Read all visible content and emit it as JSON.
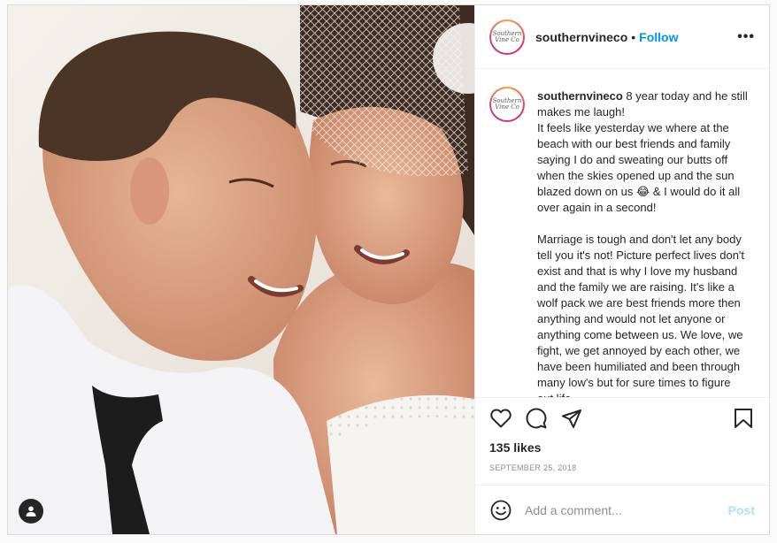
{
  "post": {
    "username": "southernvineco",
    "avatar_text": "Southern Vine Co",
    "header": {
      "separator": "•",
      "follow_label": "Follow",
      "more_label": "•••"
    },
    "caption": {
      "username": "southernvineco",
      "first_line": " 8 year today and he still makes me laugh!",
      "paragraph1": "It feels like yesterday we where at the beach with our best friends and family saying I do and sweating our butts off when the skies opened up and the sun blazed down on us 😂 & I would do it all over again in a second!",
      "paragraph2": "Marriage is tough and don't let any body tell you it's not! Picture perfect lives don't exist and that is why I love my husband and the family we are raising. It's like a wolf pack we are best friends more then anything and would not let anyone or anything come between us. We love, we fight, we get annoyed by each other, we have been humiliated and been through many low's but for sure times to figure out life"
    },
    "likes": "135 likes",
    "date": "SEPTEMBER 25, 2018",
    "comment_input": {
      "placeholder": "Add a comment...",
      "value": ""
    },
    "post_button": "Post",
    "icons": {
      "like": "heart-icon",
      "comment": "comment-icon",
      "share": "share-icon",
      "save": "bookmark-icon",
      "emoji": "emoji-icon",
      "user_tag": "user-icon"
    }
  }
}
